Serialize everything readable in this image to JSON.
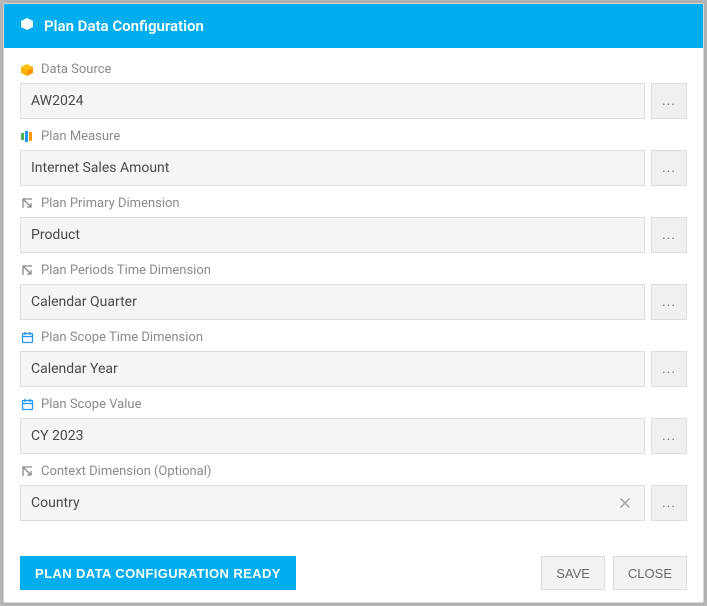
{
  "header": {
    "title": "Plan Data Configuration"
  },
  "fields": {
    "dataSource": {
      "label": "Data Source",
      "value": "AW2024"
    },
    "planMeasure": {
      "label": "Plan Measure",
      "value": "Internet Sales Amount"
    },
    "primaryDim": {
      "label": "Plan Primary Dimension",
      "value": "Product"
    },
    "periodsDim": {
      "label": "Plan Periods Time Dimension",
      "value": "Calendar Quarter"
    },
    "scopeDim": {
      "label": "Plan Scope Time Dimension",
      "value": "Calendar Year"
    },
    "scopeValue": {
      "label": "Plan Scope Value",
      "value": "CY 2023"
    },
    "contextDim": {
      "label": "Context Dimension (Optional)",
      "value": "Country"
    }
  },
  "browse_glyph": "...",
  "footer": {
    "ready": "PLAN DATA CONFIGURATION READY",
    "save": "SAVE",
    "close": "CLOSE"
  }
}
